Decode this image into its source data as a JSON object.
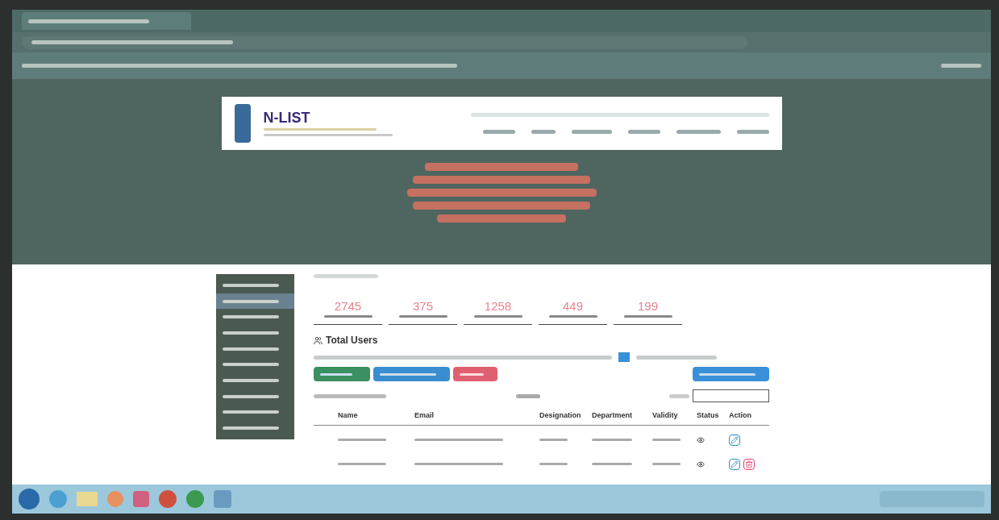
{
  "site": {
    "logo_text": "N-LIST"
  },
  "sidebar": {
    "items": [
      {
        "selected": false
      },
      {
        "selected": true
      },
      {
        "selected": false
      },
      {
        "selected": false
      },
      {
        "selected": false
      },
      {
        "selected": false
      },
      {
        "selected": false
      },
      {
        "selected": false
      },
      {
        "selected": false
      },
      {
        "selected": false
      }
    ]
  },
  "stats": [
    {
      "value": "2745"
    },
    {
      "value": "375"
    },
    {
      "value": "1258"
    },
    {
      "value": "449"
    },
    {
      "value": "199"
    }
  ],
  "section_title": "Total Users",
  "table": {
    "columns": [
      "Name",
      "Email",
      "Designation",
      "Department",
      "Validity",
      "Status",
      "Action"
    ],
    "rows": [
      {
        "actions": [
          {
            "kind": "edit"
          }
        ]
      },
      {
        "actions": [
          {
            "kind": "edit"
          },
          {
            "kind": "delete"
          }
        ]
      }
    ]
  }
}
